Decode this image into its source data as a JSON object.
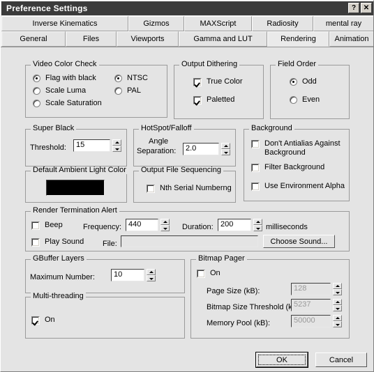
{
  "window": {
    "title": "Preference Settings",
    "help_button": "?",
    "close_button": "✕"
  },
  "tabs": {
    "row_top": [
      {
        "label": "Inverse Kinematics",
        "active": false
      },
      {
        "label": "Gizmos",
        "active": false
      },
      {
        "label": "MAXScript",
        "active": false
      },
      {
        "label": "Radiosity",
        "active": false
      },
      {
        "label": "mental ray",
        "active": false
      }
    ],
    "row_bottom": [
      {
        "label": "General",
        "active": false
      },
      {
        "label": "Files",
        "active": false
      },
      {
        "label": "Viewports",
        "active": false
      },
      {
        "label": "Gamma and LUT",
        "active": false
      },
      {
        "label": "Rendering",
        "active": true
      },
      {
        "label": "Animation",
        "active": false
      }
    ]
  },
  "video_color_check": {
    "title": "Video Color Check",
    "options": [
      {
        "label": "Flag with black",
        "selected": true
      },
      {
        "label": "Scale Luma",
        "selected": false
      },
      {
        "label": "Scale Saturation",
        "selected": false
      }
    ],
    "standards": [
      {
        "label": "NTSC",
        "selected": true
      },
      {
        "label": "PAL",
        "selected": false
      }
    ]
  },
  "output_dithering": {
    "title": "Output Dithering",
    "items": [
      {
        "label": "True Color",
        "checked": true
      },
      {
        "label": "Paletted",
        "checked": true
      }
    ]
  },
  "field_order": {
    "title": "Field Order",
    "options": [
      {
        "label": "Odd",
        "selected": true
      },
      {
        "label": "Even",
        "selected": false
      }
    ]
  },
  "super_black": {
    "title": "Super Black",
    "threshold_label": "Threshold:",
    "threshold_value": "15"
  },
  "hotspot_falloff": {
    "title": "HotSpot/Falloff",
    "angle_label_line1": "Angle",
    "angle_label_line2": "Separation:",
    "angle_value": "2.0"
  },
  "background": {
    "title": "Background",
    "items": [
      {
        "label": "Don't Antialias Against Background",
        "checked": false
      },
      {
        "label": "Filter Background",
        "checked": false
      },
      {
        "label": "Use Environment Alpha",
        "checked": false
      }
    ]
  },
  "ambient_light": {
    "title": "Default Ambient Light Color",
    "color": "#000000"
  },
  "output_file_sequencing": {
    "title": "Output File Sequencing",
    "nth_serial_label": "Nth Serial Numberng",
    "nth_serial_checked": false
  },
  "render_termination_alert": {
    "title": "Render Termination Alert",
    "beep_label": "Beep",
    "beep_checked": false,
    "frequency_label": "Frequency:",
    "frequency_value": "440",
    "duration_label": "Duration:",
    "duration_value": "200",
    "milliseconds_label": "milliseconds",
    "play_sound_label": "Play Sound",
    "play_sound_checked": false,
    "file_label": "File:",
    "file_value": "",
    "choose_sound_label": "Choose Sound..."
  },
  "gbuffer_layers": {
    "title": "GBuffer Layers",
    "maximum_number_label": "Maximum Number:",
    "maximum_number_value": "10"
  },
  "multi_threading": {
    "title": "Multi-threading",
    "on_label": "On",
    "on_checked": true
  },
  "bitmap_pager": {
    "title": "Bitmap Pager",
    "on_label": "On",
    "on_checked": false,
    "rows": [
      {
        "label": "Page Size (kB):",
        "value": "128"
      },
      {
        "label": "Bitmap Size Threshold (kB):",
        "value": "5237"
      },
      {
        "label": "Memory Pool (kB):",
        "value": "50000"
      }
    ]
  },
  "footer": {
    "ok_label": "OK",
    "cancel_label": "Cancel"
  }
}
